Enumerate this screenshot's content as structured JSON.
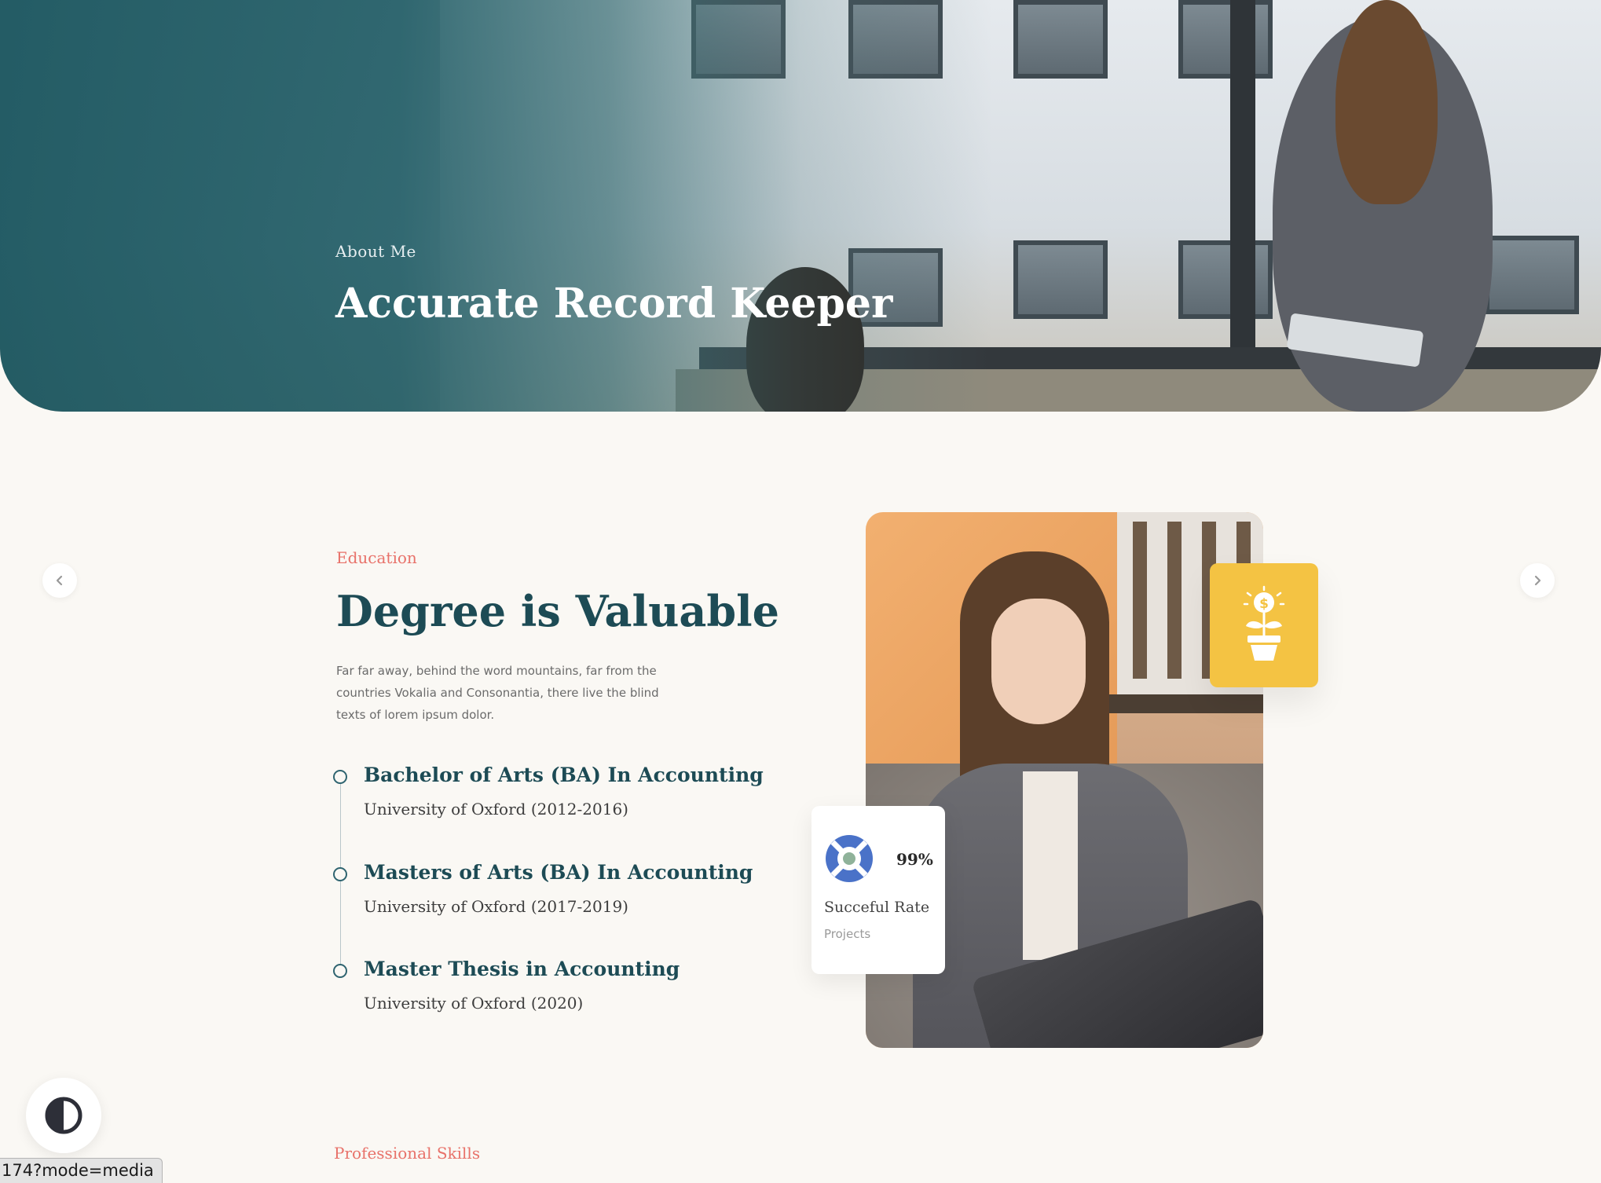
{
  "hero": {
    "eyebrow": "About Me",
    "title": "Accurate Record Keeper"
  },
  "education": {
    "eyebrow": "Education",
    "title": "Degree is Valuable",
    "description": "Far far away, behind the word mountains, far from the countries Vokalia and Consonantia, there live the blind texts of lorem ipsum dolor.",
    "timeline": [
      {
        "title": "Bachelor of Arts (BA) In Accounting",
        "subtitle": "University of Oxford (2012-2016)"
      },
      {
        "title": "Masters of Arts (BA) In Accounting",
        "subtitle": "University of Oxford (2017-2019)"
      },
      {
        "title": "Master Thesis in Accounting",
        "subtitle": "University of Oxford (2020)"
      }
    ]
  },
  "stat_card": {
    "value": "99%",
    "label": "Succeful Rate",
    "sublabel": "Projects",
    "icon": "lifebuoy-icon"
  },
  "yellow_card": {
    "icon": "money-plant-icon"
  },
  "nav": {
    "prev_icon": "chevron-left-icon",
    "next_icon": "chevron-right-icon"
  },
  "skills": {
    "eyebrow": "Professional Skills"
  },
  "theme_toggle": {
    "icon": "contrast-icon"
  },
  "status_bar": {
    "url": "174?mode=media"
  },
  "colors": {
    "primary": "#1d4b55",
    "accent": "#e8726a",
    "yellow": "#f4c343",
    "background": "#faf8f4"
  }
}
